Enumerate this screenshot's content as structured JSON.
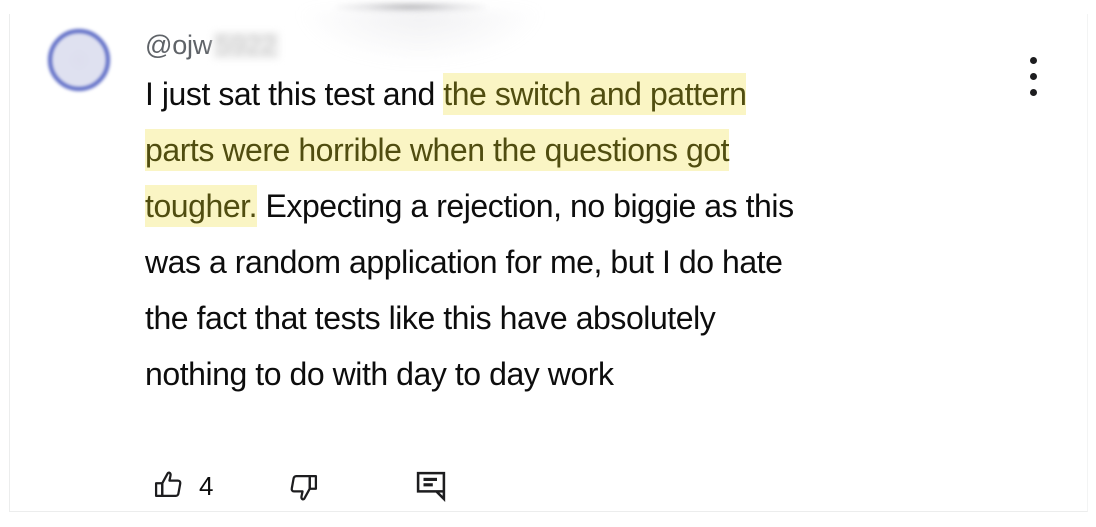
{
  "comment": {
    "author": {
      "handle": "@ojw",
      "handle_redacted": "5922",
      "avatar_icon": "user-avatar-circle"
    },
    "text": {
      "segments": [
        {
          "text": "I just sat this test and ",
          "highlight": false
        },
        {
          "text": "the switch and pattern parts were horrible when the questions got tougher.",
          "highlight": true
        },
        {
          "text": " Expecting a rejection, no biggie as this was a random application for me, but I do hate the fact that tests like this have absolutely nothing to do with day to day work",
          "highlight": false
        }
      ],
      "plain": "I just sat this test and the switch and pattern parts were horrible when the questions got tougher. Expecting a rejection, no biggie as this was a random application for me, but I do hate the fact that tests like this have absolutely nothing to do with day to day work",
      "line_1_pre": "I just sat this test and ",
      "line_1_hl": "the switch and pattern",
      "line_2_hl": "parts were horrible when the questions got",
      "line_3_hl": "tougher.",
      "line_3_post": " Expecting a rejection, no biggie as this",
      "line_4": "was a random application for me, but I do hate",
      "line_5": "the fact that tests like this have absolutely",
      "line_6": "nothing to do with day to day work"
    },
    "actions": {
      "like": {
        "icon": "thumb-up-icon",
        "count": "4"
      },
      "dislike": {
        "icon": "thumb-down-icon",
        "count": ""
      },
      "reply": {
        "icon": "comment-bubble-icon",
        "count": ""
      }
    },
    "more_options": {
      "icon": "more-vertical-icon",
      "label": ""
    }
  },
  "colors": {
    "highlight_background": "#faf5c4",
    "highlight_text": "#504d10",
    "body_text": "#0d0d0d",
    "handle_text": "#5f6368",
    "avatar_ring": "#5968c4",
    "avatar_fill": "#dfe1f0",
    "divider": "#eceded",
    "page_background": "#ffffff"
  }
}
